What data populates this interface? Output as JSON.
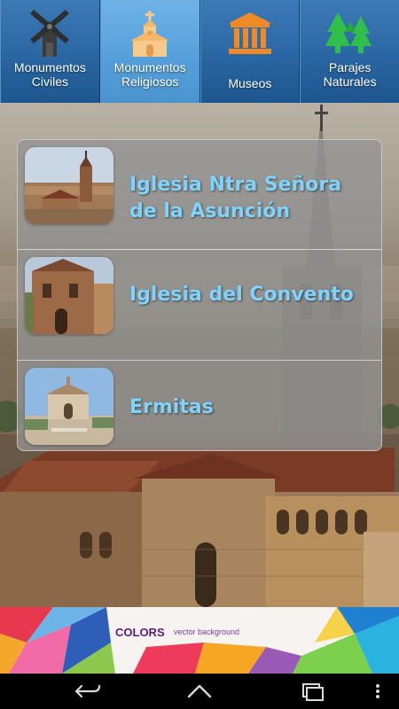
{
  "tabs": [
    {
      "label": "Monumentos\nCiviles",
      "icon": "windmill-icon",
      "active": false
    },
    {
      "label": "Monumentos\nReligiosos",
      "icon": "chapel-icon",
      "active": true
    },
    {
      "label": "Museos",
      "icon": "museum-icon",
      "active": false
    },
    {
      "label": "Parajes\nNaturales",
      "icon": "pine-trees-icon",
      "active": false
    }
  ],
  "list": {
    "items": [
      {
        "title": "Iglesia Ntra Señora de la Asunción",
        "thumbnail": "church-tower-photo"
      },
      {
        "title": "Iglesia del Convento",
        "thumbnail": "convent-photo"
      },
      {
        "title": "Ermitas",
        "thumbnail": "hermitage-photo"
      }
    ]
  },
  "ad": {
    "brand": "COLORS",
    "subtitle": "vector background"
  },
  "navbar": {
    "back": "back-icon",
    "home": "home-icon",
    "recents": "recent-apps-icon",
    "menu": "overflow-menu-icon"
  },
  "colors": {
    "tab_bar": "#2a66a2",
    "tab_active": "#55a0da",
    "list_title": "#7fd3ff",
    "museum_orange": "#f08a24",
    "trees_green": "#2fbf4a"
  }
}
